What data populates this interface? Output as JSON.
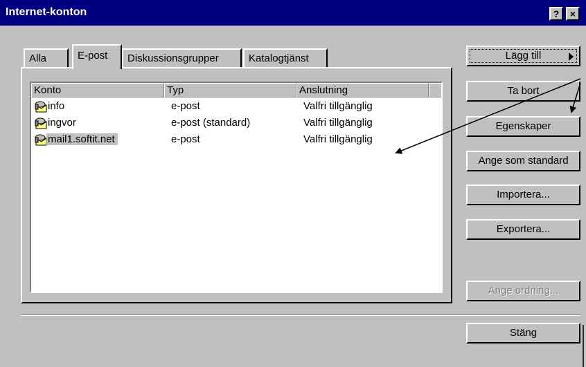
{
  "window": {
    "title": "Internet-konton",
    "help_label": "?",
    "close_label": "×"
  },
  "tabs": [
    {
      "label": "Alla"
    },
    {
      "label": "E-post"
    },
    {
      "label": "Diskussionsgrupper"
    },
    {
      "label": "Katalogtjänst"
    }
  ],
  "list": {
    "columns": [
      "Konto",
      "Typ",
      "Anslutning"
    ],
    "rows": [
      {
        "konto": "info",
        "typ": "e-post",
        "anslutning": "Valfri tillgänglig"
      },
      {
        "konto": "ingvor",
        "typ": "e-post (standard)",
        "anslutning": "Valfri tillgänglig"
      },
      {
        "konto": "mail1.softit.net",
        "typ": "e-post",
        "anslutning": "Valfri tillgänglig"
      }
    ]
  },
  "buttons": {
    "add": "Lägg till",
    "remove": "Ta bort",
    "properties": "Egenskaper",
    "set_default": "Ange som standard",
    "import": "Importera...",
    "export": "Exportera...",
    "order": "Ange ordning...",
    "close": "Stäng"
  },
  "colors": {
    "titlebar": "#000080",
    "face": "#c0c0c0"
  }
}
